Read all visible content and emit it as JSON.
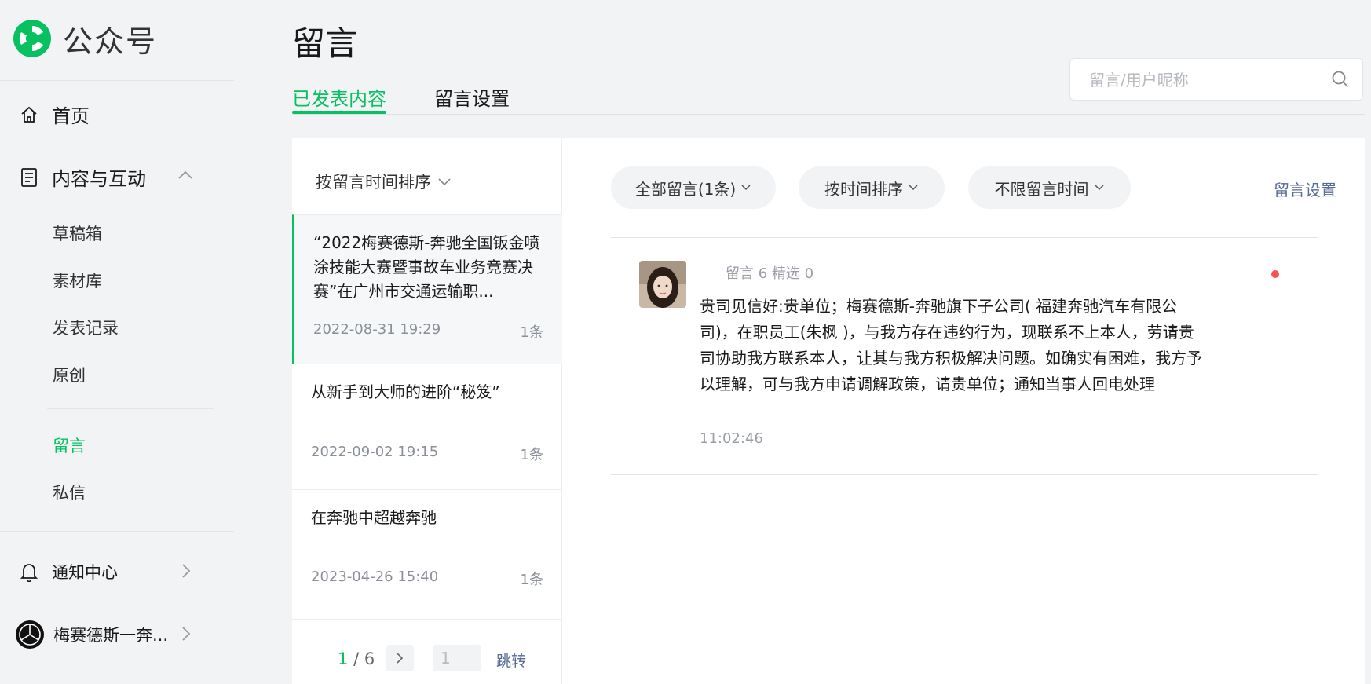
{
  "brand": {
    "name": "公众号"
  },
  "sidebar": {
    "home": "首页",
    "content_group": "内容与互动",
    "sub_items": [
      "草稿箱",
      "素材库",
      "发表记录",
      "原创"
    ],
    "comments": "留言",
    "messages": "私信",
    "notifications": "通知中心",
    "account": "梅赛德斯一奔..."
  },
  "header": {
    "title": "留言",
    "tabs": [
      {
        "label": "已发表内容",
        "active": true
      },
      {
        "label": "留言设置",
        "active": false
      }
    ],
    "search_placeholder": "留言/用户昵称"
  },
  "article_list": {
    "sort_label": "按留言时间排序",
    "articles": [
      {
        "title": "“2022梅赛德斯-奔驰全国钣金喷涂技能大赛暨事故车业务竞赛决赛”在广州市交通运输职...",
        "date": "2022-08-31 19:29",
        "count": "1条",
        "active": true
      },
      {
        "title": "从新手到大师的进阶“秘笈”",
        "date": "2022-09-02 19:15",
        "count": "1条",
        "active": false
      },
      {
        "title": "在奔驰中超越奔驰",
        "date": "2023-04-26 15:40",
        "count": "1条",
        "active": false
      }
    ],
    "pager": {
      "current": "1",
      "total": "/ 6",
      "input_placeholder": "1",
      "jump_label": "跳转"
    }
  },
  "comment_panel": {
    "filters": [
      "全部留言(1条)",
      "按时间排序",
      "不限留言时间"
    ],
    "settings_link": "留言设置",
    "comment": {
      "meta": "留言 6 精选 0",
      "text": "贵司见信好:贵单位；梅赛德斯-奔驰旗下子公司( 福建奔驰汽车有限公司)，在职员工(朱枫 )，与我方存在违约行为，现联系不上本人，劳请贵司协助我方联系本人，让其与我方积极解决问题。如确实有困难，我方予以理解，可与我方申请调解政策，请贵单位；通知当事人回电处理",
      "time": "11:02:46"
    }
  },
  "colors": {
    "accent": "#07c160",
    "link": "#576b95",
    "dot": "#fa5151"
  }
}
